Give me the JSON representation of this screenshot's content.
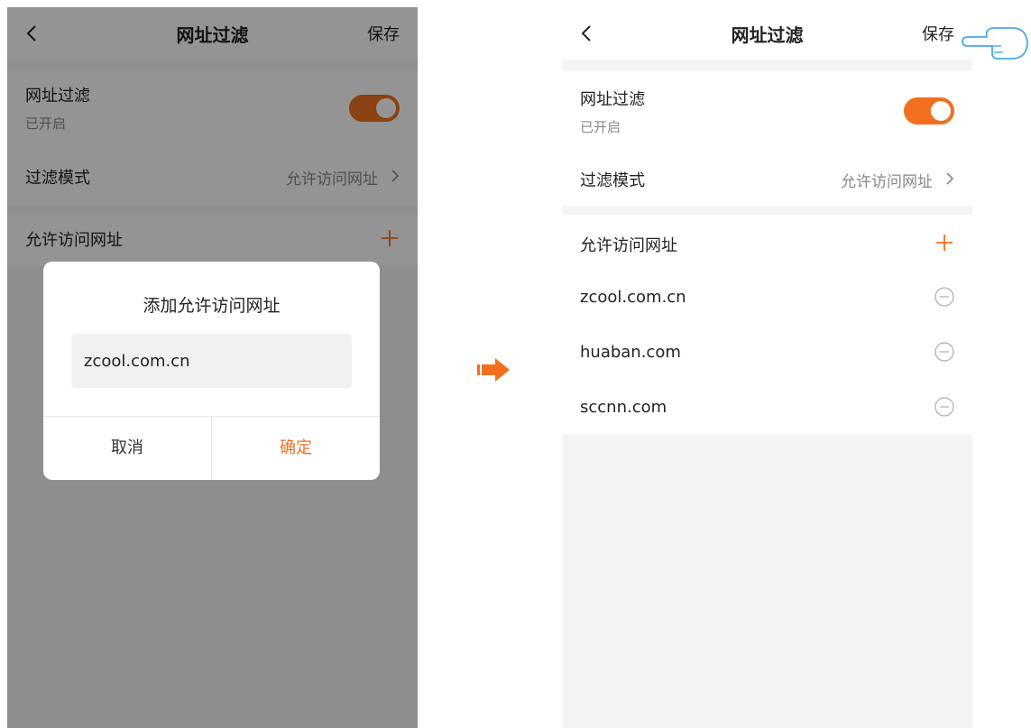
{
  "accent_color": "#f0701f",
  "left_screen": {
    "nav": {
      "back_icon": "chevron-left-icon",
      "title": "网址过滤",
      "save_label": "保存"
    },
    "filter_label": "网址过滤",
    "filter_status": "已开启",
    "filter_enabled": true,
    "mode_label": "过滤模式",
    "mode_value": "允许访问网址",
    "allowed_header": "允许访问网址",
    "dialog": {
      "title": "添加允许访问网址",
      "input_value": "zcool.com.cn",
      "cancel_label": "取消",
      "confirm_label": "确定"
    }
  },
  "right_screen": {
    "nav": {
      "back_icon": "chevron-left-icon",
      "title": "网址过滤",
      "save_label": "保存"
    },
    "filter_label": "网址过滤",
    "filter_status": "已开启",
    "filter_enabled": true,
    "mode_label": "过滤模式",
    "mode_value": "允许访问网址",
    "allowed_header": "允许访问网址",
    "urls": [
      "zcool.com.cn",
      "huaban.com",
      "sccnn.com"
    ]
  }
}
